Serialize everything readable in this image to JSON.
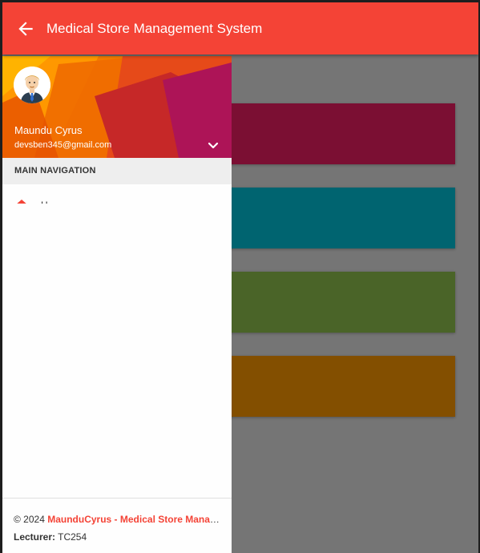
{
  "appbar": {
    "title": "Medical Store Management System",
    "back_icon": "arrow-left-icon",
    "color": "#f44336"
  },
  "user": {
    "name": "Maundu Cyrus",
    "email": "devsben345@gmail.com",
    "menu_icon": "chevron-down-icon"
  },
  "nav": {
    "header": "MAIN NAVIGATION",
    "items": [
      {
        "label": "H",
        "icon": "home-icon"
      }
    ]
  },
  "footer": {
    "copyright_prefix": "© 2024 ",
    "link_text": "MaunduCyrus - Medical Store Management System",
    "lecturer_label": "Lecturer:",
    "lecturer_value": " TC254"
  },
  "cards": [
    {
      "color": "#7b0f33"
    },
    {
      "color": "#006470"
    },
    {
      "color": "#4a6428"
    },
    {
      "color": "#834f00"
    }
  ]
}
